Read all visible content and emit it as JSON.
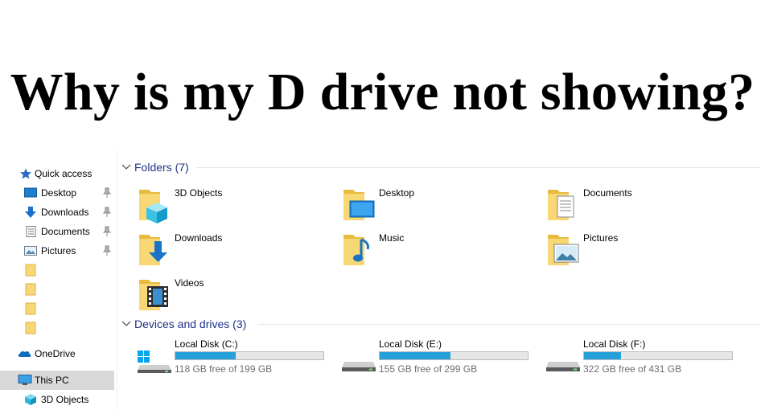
{
  "headline": "Why is my D drive not showing?",
  "colors": {
    "section_header": "#1e3287",
    "drive_bar": "#26a0da",
    "selected_bg": "#d9d9d9",
    "folder_yellow": "#f8d775"
  },
  "sidebar": {
    "quick_access": "Quick access",
    "pinned": [
      {
        "label": "Desktop",
        "icon": "desktop-icon"
      },
      {
        "label": "Downloads",
        "icon": "downloads-icon"
      },
      {
        "label": "Documents",
        "icon": "documents-icon"
      },
      {
        "label": "Pictures",
        "icon": "pictures-icon"
      }
    ],
    "onedrive": "OneDrive",
    "this_pc": "This PC",
    "objects_3d": "3D Objects"
  },
  "folders": {
    "header": "Folders (7)",
    "items": [
      {
        "label": "3D Objects",
        "icon": "3d-objects-folder-icon"
      },
      {
        "label": "Desktop",
        "icon": "desktop-folder-icon"
      },
      {
        "label": "Documents",
        "icon": "documents-folder-icon"
      },
      {
        "label": "Downloads",
        "icon": "downloads-folder-icon"
      },
      {
        "label": "Music",
        "icon": "music-folder-icon"
      },
      {
        "label": "Pictures",
        "icon": "pictures-folder-icon"
      },
      {
        "label": "Videos",
        "icon": "videos-folder-icon"
      }
    ]
  },
  "drives": {
    "header": "Devices and drives (3)",
    "items": [
      {
        "name": "Local Disk (C:)",
        "free": "118 GB free of 199 GB",
        "used_fraction": 0.41
      },
      {
        "name": "Local Disk (E:)",
        "free": "155 GB free of 299 GB",
        "used_fraction": 0.48
      },
      {
        "name": "Local Disk (F:)",
        "free": "322 GB free of 431 GB",
        "used_fraction": 0.25
      }
    ]
  }
}
